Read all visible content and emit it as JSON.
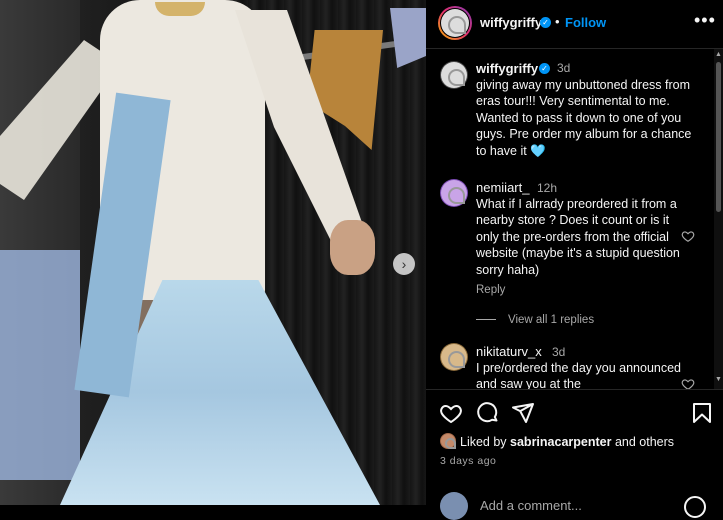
{
  "post": {
    "author": "wiffygriffy",
    "follow_label": "Follow",
    "separator": "•",
    "more_label": "•••",
    "next_label": "›"
  },
  "caption": {
    "author": "wiffygriffy",
    "time": "3d",
    "text": "giving away my unbuttoned dress from eras tour!!! Very sentimental to me. Wanted to pass it down to one of you guys. Pre order my album for a chance to have it 🩵"
  },
  "comments": [
    {
      "user": "nemiiart_",
      "time": "12h",
      "text": "What if I alrrady preordered it from a nearby store ? Does it count or is it only the pre-orders from the official website (maybe it's a stupid question sorry haha)",
      "reply_label": "Reply",
      "view_replies": "View all 1 replies"
    },
    {
      "user": "nikitaturv_x",
      "time": "3d",
      "text": "I pre/ordered the day you announced and saw you at the"
    }
  ],
  "footer": {
    "liked_by_prefix": "Liked by ",
    "liked_by_user": "sabrinacarpenter",
    "liked_by_suffix": " and others",
    "time_ago": "3 days ago",
    "add_comment_placeholder": "Add a comment..."
  },
  "colors": {
    "accent": "#0095f6",
    "background": "#000000",
    "muted": "#a8a8a8"
  },
  "icons": [
    "heart-icon",
    "comment-icon",
    "share-icon",
    "bookmark-icon",
    "verified-icon",
    "more-icon",
    "chevron-right-icon"
  ]
}
